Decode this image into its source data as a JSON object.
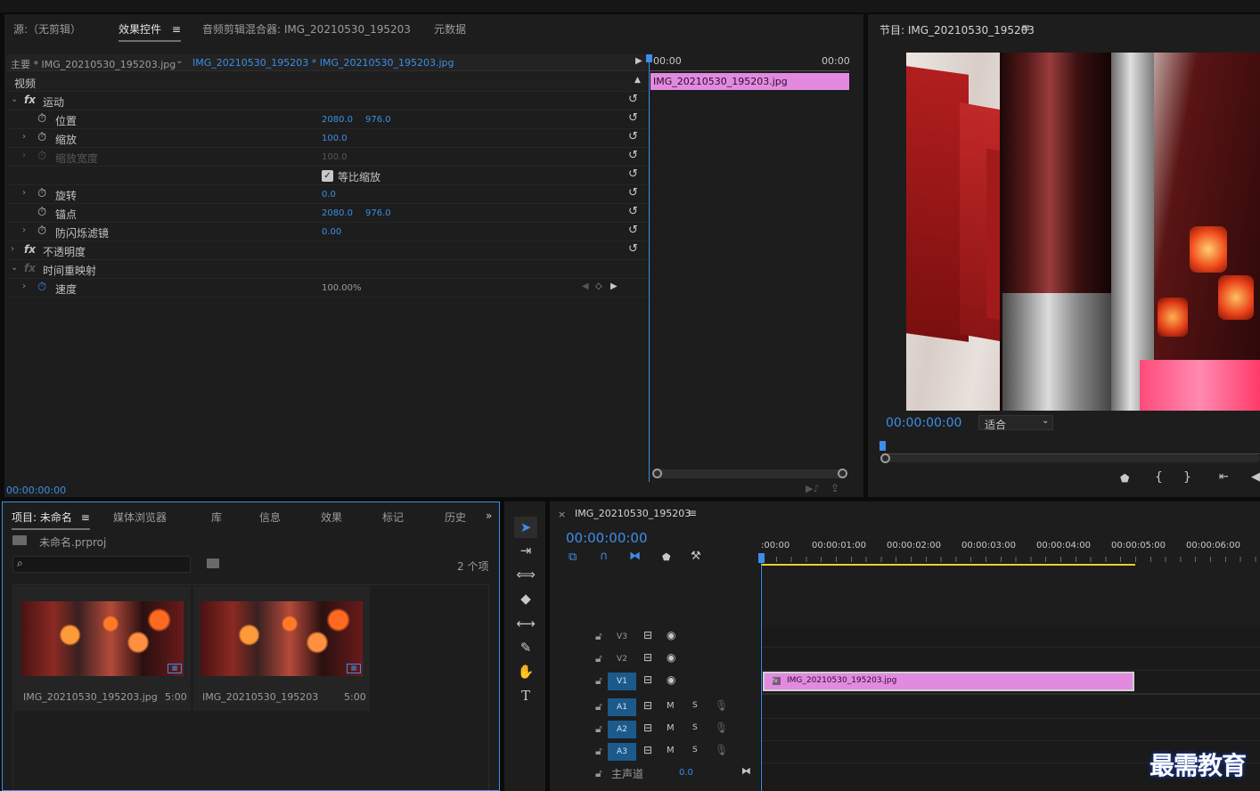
{
  "source_panel": {
    "tabs": [
      "源:（无剪辑）",
      "效果控件",
      "音频剪辑混合器: IMG_20210530_195203",
      "元数据"
    ],
    "active_tab_menu": "≡",
    "master_label": "主要 * IMG_20210530_195203.jpg",
    "clip_label": "IMG_20210530_195203 * IMG_20210530_195203.jpg",
    "mini_tc_start": "00:00",
    "mini_tc_end": "00:00",
    "mini_clip_name": "IMG_20210530_195203.jpg",
    "section_video": "视频",
    "fx_motion": "运动",
    "prop_position": "位置",
    "pos_x": "2080.0",
    "pos_y": "976.0",
    "prop_scale": "缩放",
    "scale_val": "100.0",
    "prop_scale_width": "缩放宽度",
    "scale_width_val": "100.0",
    "uniform_scale": "等比缩放",
    "prop_rotation": "旋转",
    "rotation_val": "0.0",
    "prop_anchor": "锚点",
    "anchor_x": "2080.0",
    "anchor_y": "976.0",
    "prop_flicker": "防闪烁滤镜",
    "flicker_val": "0.00",
    "fx_opacity": "不透明度",
    "fx_time_remap": "时间重映射",
    "prop_speed": "速度",
    "speed_val": "100.00%",
    "footer_tc": "00:00:00:00"
  },
  "program_panel": {
    "title": "节目: IMG_20210530_195203",
    "timecode": "00:00:00:00",
    "fit_label": "适合"
  },
  "project_panel": {
    "tabs": [
      "项目: 未命名",
      "媒体浏览器",
      "库",
      "信息",
      "效果",
      "标记",
      "历史"
    ],
    "project_file": "未命名.prproj",
    "item_count": "2 个项",
    "items": [
      {
        "name": "IMG_20210530_195203.jpg",
        "duration": "5:00"
      },
      {
        "name": "IMG_20210530_195203",
        "duration": "5:00"
      }
    ]
  },
  "timeline_panel": {
    "sequence_name": "IMG_20210530_195203",
    "timecode": "00:00:00:00",
    "ruler": [
      ":00:00",
      "00:00:01:00",
      "00:00:02:00",
      "00:00:03:00",
      "00:00:04:00",
      "00:00:05:00",
      "00:00:06:00"
    ],
    "video_tracks": [
      "V3",
      "V2",
      "V1"
    ],
    "audio_tracks": [
      "A1",
      "A2",
      "A3"
    ],
    "mute": "M",
    "solo": "S",
    "master_label": "主声道",
    "master_val": "0.0",
    "clip_name": "IMG_20210530_195203.jpg"
  },
  "watermark": "最需教育",
  "colors": {
    "accent_blue": "#3d8ee8",
    "clip_pink": "#e28ae0",
    "work_area_yellow": "#e6d22a",
    "track_target_blue": "#1c5a8c"
  }
}
